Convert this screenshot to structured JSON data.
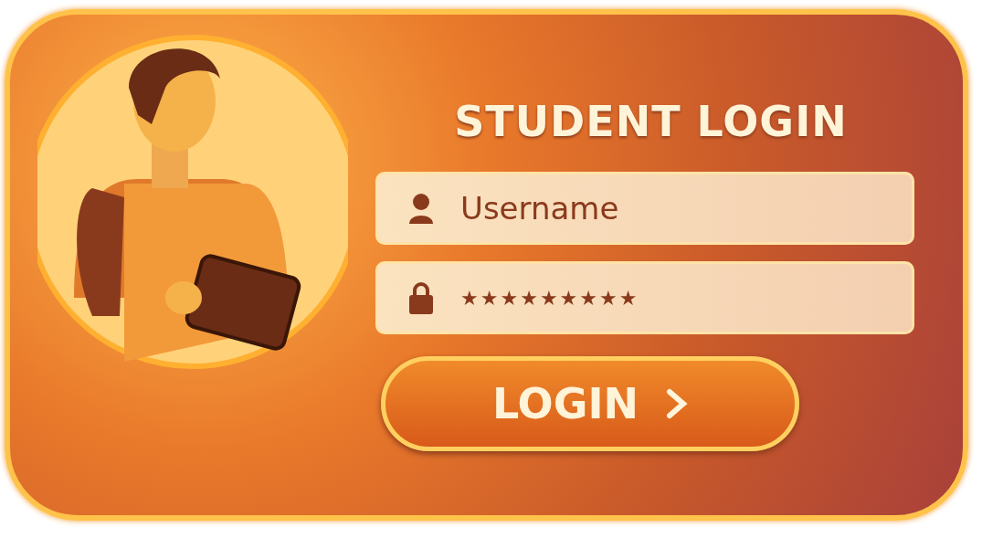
{
  "title": "STUDENT LOGIN",
  "fields": [
    {
      "kind": "username",
      "placeholder": "Username"
    },
    {
      "kind": "password",
      "value": "★★★★★★★★★"
    }
  ],
  "button": {
    "label": "LOGIN"
  }
}
